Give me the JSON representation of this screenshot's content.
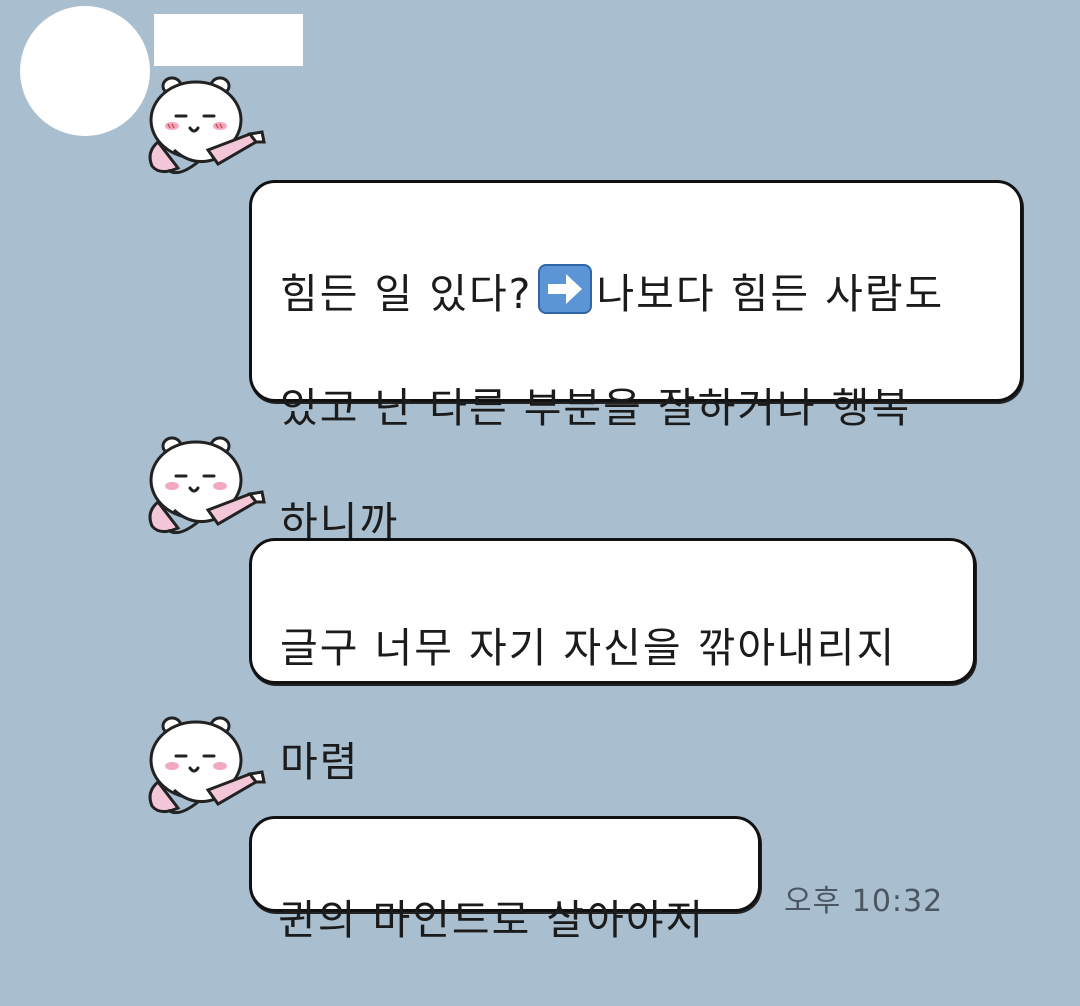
{
  "messages": [
    {
      "before_emoji": "힘든 일 있다?",
      "emoji": "arrow-right-emoji",
      "after_emoji": "나보다 힘든 사람도",
      "line2": "있고 난 다른 부분을 잘하거나 행복",
      "line3": "하니까"
    },
    {
      "line1": "글구 너무 자기 자신을 깎아내리지",
      "line2": "마렴"
    },
    {
      "line1": "퀸의 마인드로 살아야지"
    }
  ],
  "timestamp": "오후 10:32",
  "sticker": "bear-with-hairdryer-sticker",
  "colors": {
    "background": "#a9bfd0",
    "bubble": "#ffffff",
    "bubble_border": "#111111",
    "text": "#1b1b1b",
    "timestamp": "#4a5662"
  }
}
